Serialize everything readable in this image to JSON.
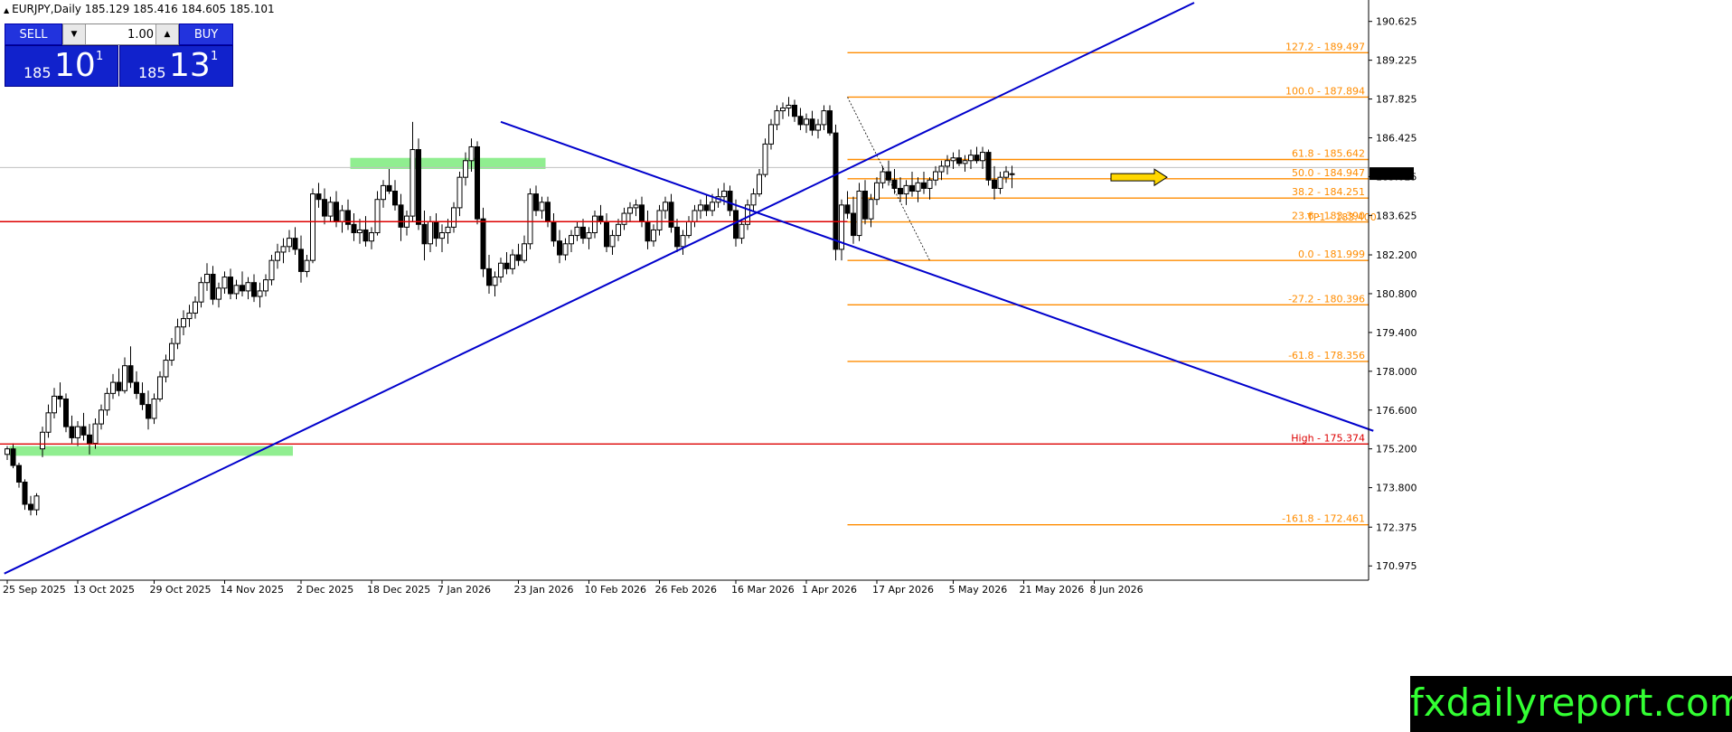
{
  "symbol_info": "EURJPY,Daily  185.129 185.416 184.605 185.101",
  "trade_panel": {
    "sell_label": "SELL",
    "buy_label": "BUY",
    "lot_value": "1.00",
    "sell_price_small": "185",
    "sell_price_big": "10",
    "sell_price_sup": "1",
    "buy_price_small": "185",
    "buy_price_big": "13",
    "buy_price_sup": "1"
  },
  "watermark": "fxdailyreport.com",
  "colors": {
    "trendline": "#0000cc",
    "fib": "#ff8c00",
    "support": "#dd0000",
    "zone": "#90ee90",
    "arrow": "#ffd700"
  },
  "chart_data": {
    "type": "candlestick",
    "title": "",
    "ylim": [
      170.2,
      191.3
    ],
    "current_price": "185.101",
    "y_ticks": [
      "190.625",
      "189.225",
      "187.825",
      "186.425",
      "185.025",
      "183.625",
      "182.200",
      "180.800",
      "179.400",
      "178.000",
      "176.600",
      "175.200",
      "173.800",
      "172.375",
      "170.975"
    ],
    "x_ticks": [
      {
        "label": "25 Sep 2025",
        "i": 0
      },
      {
        "label": "13 Oct 2025",
        "i": 12
      },
      {
        "label": "29 Oct 2025",
        "i": 25
      },
      {
        "label": "14 Nov 2025",
        "i": 37
      },
      {
        "label": "2 Dec 2025",
        "i": 50
      },
      {
        "label": "18 Dec 2025",
        "i": 62
      },
      {
        "label": "7 Jan 2026",
        "i": 74
      },
      {
        "label": "23 Jan 2026",
        "i": 87
      },
      {
        "label": "10 Feb 2026",
        "i": 99
      },
      {
        "label": "26 Feb 2026",
        "i": 111
      },
      {
        "label": "16 Mar 2026",
        "i": 124
      },
      {
        "label": "1 Apr 2026",
        "i": 136
      },
      {
        "label": "17 Apr 2026",
        "i": 148
      },
      {
        "label": "5 May 2026",
        "i": 161
      },
      {
        "label": "21 May 2026",
        "i": 173
      },
      {
        "label": "8 Jun 2026",
        "i": 185
      }
    ],
    "fib_levels": [
      {
        "label": "127.2 - 189.497",
        "value": 189.497
      },
      {
        "label": "100.0 - 187.894",
        "value": 187.894
      },
      {
        "label": "61.8 - 185.642",
        "value": 185.642
      },
      {
        "label": "50.0 - 184.947",
        "value": 184.947
      },
      {
        "label": "38.2 - 184.251",
        "value": 184.251
      },
      {
        "label": "23.6 - 183.390",
        "value": 183.39
      },
      {
        "label": "0.0 - 181.999",
        "value": 181.999
      },
      {
        "label": "-27.2 - 180.396",
        "value": 180.396
      },
      {
        "label": "-61.8 - 178.356",
        "value": 178.356
      },
      {
        "label": "-161.8 - 172.461",
        "value": 172.461
      }
    ],
    "tp_label": "TP1 - 183.400",
    "support_lines": [
      {
        "value": 183.4,
        "label": ""
      },
      {
        "value": 175.374,
        "label": "High - 175.374"
      }
    ],
    "zones": [
      {
        "i0": 1,
        "i1": 48,
        "ylow": 174.95,
        "yhigh": 175.3
      },
      {
        "i0": 59,
        "i1": 91,
        "ylow": 185.3,
        "yhigh": 185.7
      }
    ],
    "trendlines": [
      {
        "i0": -0.5,
        "y0": 170.7,
        "i1": 202,
        "y1": 191.3
      },
      {
        "i0": 84,
        "y0": 187.0,
        "i1": 232.5,
        "y1": 175.85
      }
    ],
    "candles": [
      [
        175.0,
        175.3,
        174.8,
        175.2
      ],
      [
        175.2,
        175.4,
        174.5,
        174.6
      ],
      [
        174.6,
        174.7,
        173.8,
        174.0
      ],
      [
        174.0,
        174.1,
        173.0,
        173.2
      ],
      [
        173.2,
        173.5,
        172.8,
        173.0
      ],
      [
        173.0,
        173.6,
        172.8,
        173.5
      ],
      [
        175.2,
        176.0,
        174.9,
        175.8
      ],
      [
        175.8,
        176.8,
        175.6,
        176.5
      ],
      [
        176.5,
        177.4,
        176.3,
        177.1
      ],
      [
        177.1,
        177.6,
        176.7,
        177.0
      ],
      [
        177.0,
        177.2,
        175.8,
        176.0
      ],
      [
        176.0,
        176.4,
        175.4,
        175.6
      ],
      [
        175.6,
        176.2,
        175.3,
        176.0
      ],
      [
        176.0,
        176.5,
        175.5,
        175.7
      ],
      [
        175.7,
        176.1,
        175.0,
        175.4
      ],
      [
        175.4,
        176.3,
        175.2,
        176.1
      ],
      [
        176.1,
        176.8,
        175.9,
        176.6
      ],
      [
        176.6,
        177.4,
        176.4,
        177.2
      ],
      [
        177.2,
        177.9,
        177.0,
        177.6
      ],
      [
        177.6,
        178.1,
        177.1,
        177.3
      ],
      [
        177.3,
        178.5,
        177.2,
        178.2
      ],
      [
        178.2,
        178.9,
        177.4,
        177.6
      ],
      [
        177.6,
        178.0,
        177.0,
        177.2
      ],
      [
        177.2,
        177.6,
        176.6,
        176.8
      ],
      [
        176.8,
        177.3,
        175.9,
        176.3
      ],
      [
        176.3,
        177.2,
        176.1,
        177.0
      ],
      [
        177.0,
        178.0,
        176.9,
        177.8
      ],
      [
        177.8,
        178.6,
        177.6,
        178.4
      ],
      [
        178.4,
        179.2,
        178.2,
        179.0
      ],
      [
        179.0,
        179.9,
        178.8,
        179.6
      ],
      [
        179.6,
        180.2,
        179.3,
        179.9
      ],
      [
        179.9,
        180.4,
        179.6,
        180.1
      ],
      [
        180.1,
        180.7,
        179.9,
        180.5
      ],
      [
        180.5,
        181.4,
        180.3,
        181.2
      ],
      [
        181.2,
        181.9,
        180.9,
        181.5
      ],
      [
        181.5,
        181.8,
        180.4,
        180.6
      ],
      [
        180.6,
        181.2,
        180.3,
        181.0
      ],
      [
        181.0,
        181.6,
        180.8,
        181.4
      ],
      [
        181.4,
        181.7,
        180.6,
        180.8
      ],
      [
        180.8,
        181.3,
        180.6,
        181.1
      ],
      [
        181.1,
        181.6,
        180.7,
        180.9
      ],
      [
        180.9,
        181.4,
        180.6,
        181.2
      ],
      [
        181.2,
        181.5,
        180.5,
        180.7
      ],
      [
        180.7,
        181.2,
        180.3,
        180.9
      ],
      [
        180.9,
        181.5,
        180.7,
        181.3
      ],
      [
        181.3,
        182.2,
        181.1,
        182.0
      ],
      [
        182.0,
        182.6,
        181.7,
        182.3
      ],
      [
        182.3,
        182.8,
        181.9,
        182.5
      ],
      [
        182.5,
        183.1,
        182.3,
        182.8
      ],
      [
        182.8,
        183.2,
        182.2,
        182.4
      ],
      [
        182.4,
        182.9,
        181.2,
        181.6
      ],
      [
        181.6,
        182.2,
        181.4,
        182.0
      ],
      [
        182.0,
        184.6,
        181.9,
        184.4
      ],
      [
        184.4,
        184.8,
        183.9,
        184.2
      ],
      [
        184.2,
        184.6,
        183.3,
        183.6
      ],
      [
        183.6,
        184.3,
        183.4,
        184.1
      ],
      [
        184.1,
        184.5,
        183.2,
        183.4
      ],
      [
        183.4,
        184.0,
        183.0,
        183.8
      ],
      [
        183.8,
        184.2,
        183.1,
        183.3
      ],
      [
        183.3,
        183.7,
        182.7,
        183.0
      ],
      [
        183.0,
        183.5,
        182.6,
        183.1
      ],
      [
        183.1,
        183.6,
        182.5,
        182.7
      ],
      [
        182.7,
        183.2,
        182.4,
        183.0
      ],
      [
        183.0,
        184.5,
        182.9,
        184.2
      ],
      [
        184.2,
        184.9,
        183.9,
        184.7
      ],
      [
        184.7,
        185.3,
        184.4,
        184.5
      ],
      [
        184.5,
        184.9,
        183.8,
        184.0
      ],
      [
        184.0,
        184.4,
        182.7,
        183.2
      ],
      [
        183.2,
        183.8,
        182.9,
        183.6
      ],
      [
        183.6,
        187.0,
        183.4,
        186.0
      ],
      [
        186.0,
        186.4,
        183.1,
        183.3
      ],
      [
        183.3,
        183.8,
        182.0,
        182.6
      ],
      [
        182.6,
        183.6,
        182.3,
        183.4
      ],
      [
        183.4,
        183.7,
        182.5,
        182.8
      ],
      [
        182.8,
        183.3,
        182.3,
        183.0
      ],
      [
        183.0,
        183.5,
        182.6,
        183.2
      ],
      [
        183.2,
        184.1,
        183.0,
        183.9
      ],
      [
        183.9,
        185.2,
        183.6,
        185.0
      ],
      [
        185.0,
        185.9,
        184.7,
        185.6
      ],
      [
        185.6,
        186.4,
        185.2,
        186.1
      ],
      [
        186.1,
        186.3,
        183.3,
        183.5
      ],
      [
        183.5,
        183.9,
        181.4,
        181.7
      ],
      [
        181.7,
        182.2,
        180.8,
        181.1
      ],
      [
        181.1,
        181.6,
        180.7,
        181.4
      ],
      [
        181.4,
        182.1,
        181.2,
        181.9
      ],
      [
        181.9,
        182.3,
        181.5,
        181.7
      ],
      [
        181.7,
        182.4,
        181.5,
        182.2
      ],
      [
        182.2,
        182.6,
        181.8,
        182.0
      ],
      [
        182.0,
        182.9,
        181.9,
        182.6
      ],
      [
        182.6,
        184.6,
        182.4,
        184.4
      ],
      [
        184.4,
        184.7,
        183.6,
        183.8
      ],
      [
        183.8,
        184.3,
        183.5,
        184.1
      ],
      [
        184.1,
        184.3,
        183.2,
        183.4
      ],
      [
        183.4,
        183.7,
        182.5,
        182.7
      ],
      [
        182.7,
        183.1,
        181.9,
        182.2
      ],
      [
        182.2,
        182.8,
        182.0,
        182.6
      ],
      [
        182.6,
        183.1,
        182.3,
        182.9
      ],
      [
        182.9,
        183.4,
        182.7,
        183.2
      ],
      [
        183.2,
        183.5,
        182.6,
        182.8
      ],
      [
        182.8,
        183.2,
        182.4,
        183.0
      ],
      [
        183.0,
        183.8,
        182.8,
        183.6
      ],
      [
        183.6,
        184.0,
        183.3,
        183.4
      ],
      [
        183.4,
        183.7,
        182.3,
        182.5
      ],
      [
        182.5,
        183.1,
        182.2,
        182.9
      ],
      [
        182.9,
        183.5,
        182.7,
        183.3
      ],
      [
        183.3,
        183.9,
        183.1,
        183.7
      ],
      [
        183.7,
        184.1,
        183.4,
        183.9
      ],
      [
        183.9,
        184.2,
        183.6,
        184.0
      ],
      [
        184.0,
        184.3,
        183.2,
        183.4
      ],
      [
        183.4,
        183.8,
        182.4,
        182.7
      ],
      [
        182.7,
        183.3,
        182.5,
        183.1
      ],
      [
        183.1,
        184.0,
        182.9,
        183.8
      ],
      [
        183.8,
        184.3,
        183.5,
        184.1
      ],
      [
        184.1,
        184.4,
        183.0,
        183.2
      ],
      [
        183.2,
        183.5,
        182.3,
        182.5
      ],
      [
        182.5,
        183.1,
        182.2,
        182.9
      ],
      [
        182.9,
        183.6,
        182.8,
        183.4
      ],
      [
        183.4,
        184.0,
        183.2,
        183.8
      ],
      [
        183.8,
        184.2,
        183.5,
        184.0
      ],
      [
        184.0,
        184.4,
        183.6,
        183.8
      ],
      [
        183.8,
        184.4,
        183.6,
        184.1
      ],
      [
        184.1,
        184.6,
        183.9,
        184.3
      ],
      [
        184.3,
        184.8,
        184.0,
        184.5
      ],
      [
        184.5,
        184.7,
        183.6,
        183.8
      ],
      [
        183.8,
        184.2,
        182.5,
        182.8
      ],
      [
        182.8,
        183.5,
        182.6,
        183.3
      ],
      [
        183.3,
        184.2,
        183.1,
        184.0
      ],
      [
        184.0,
        184.6,
        183.8,
        184.4
      ],
      [
        184.4,
        185.3,
        184.3,
        185.1
      ],
      [
        185.1,
        186.4,
        185.0,
        186.2
      ],
      [
        186.2,
        187.1,
        186.0,
        186.9
      ],
      [
        186.9,
        187.6,
        186.7,
        187.4
      ],
      [
        187.4,
        187.7,
        187.1,
        187.5
      ],
      [
        187.5,
        187.9,
        187.2,
        187.6
      ],
      [
        187.6,
        187.8,
        187.0,
        187.2
      ],
      [
        187.2,
        187.5,
        186.7,
        186.9
      ],
      [
        186.9,
        187.3,
        186.6,
        187.1
      ],
      [
        187.1,
        187.4,
        186.5,
        186.7
      ],
      [
        186.7,
        187.1,
        186.4,
        186.9
      ],
      [
        186.9,
        187.6,
        186.7,
        187.4
      ],
      [
        187.4,
        187.6,
        186.5,
        186.6
      ],
      [
        186.6,
        186.9,
        182.0,
        182.4
      ],
      [
        182.4,
        184.2,
        182.0,
        184.0
      ],
      [
        184.0,
        184.5,
        183.5,
        183.7
      ],
      [
        183.7,
        184.3,
        182.6,
        182.9
      ],
      [
        182.9,
        184.8,
        182.7,
        184.5
      ],
      [
        184.5,
        184.9,
        183.3,
        183.5
      ],
      [
        183.5,
        184.4,
        183.2,
        184.2
      ],
      [
        184.2,
        185.0,
        184.0,
        184.8
      ],
      [
        184.8,
        185.4,
        184.6,
        185.2
      ],
      [
        185.2,
        185.6,
        184.7,
        184.9
      ],
      [
        184.9,
        185.3,
        184.4,
        184.6
      ],
      [
        184.6,
        185.0,
        184.1,
        184.4
      ],
      [
        184.4,
        184.9,
        184.0,
        184.7
      ],
      [
        184.7,
        185.2,
        184.3,
        184.5
      ],
      [
        184.5,
        185.0,
        184.1,
        184.8
      ],
      [
        184.8,
        185.2,
        184.4,
        184.6
      ],
      [
        184.6,
        185.0,
        184.2,
        184.9
      ],
      [
        184.9,
        185.4,
        184.7,
        185.2
      ],
      [
        185.2,
        185.6,
        184.9,
        185.4
      ],
      [
        185.4,
        185.8,
        185.1,
        185.6
      ],
      [
        185.6,
        185.9,
        185.3,
        185.7
      ],
      [
        185.7,
        186.0,
        185.4,
        185.5
      ],
      [
        185.5,
        185.8,
        185.2,
        185.6
      ],
      [
        185.6,
        186.0,
        185.3,
        185.8
      ],
      [
        185.8,
        186.1,
        185.5,
        185.6
      ],
      [
        185.6,
        186.1,
        185.3,
        185.9
      ],
      [
        185.9,
        186.0,
        184.7,
        184.9
      ],
      [
        184.9,
        185.4,
        184.2,
        184.6
      ],
      [
        184.6,
        185.2,
        184.4,
        185.0
      ],
      [
        185.0,
        185.4,
        184.8,
        185.2
      ],
      [
        185.129,
        185.416,
        184.605,
        185.101
      ]
    ]
  }
}
